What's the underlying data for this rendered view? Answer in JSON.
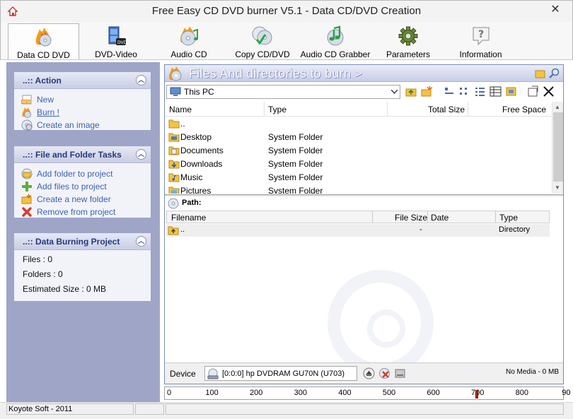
{
  "window": {
    "title": "Free Easy CD DVD burner V5.1 - Data CD/DVD Creation",
    "close_glyph": "✕"
  },
  "toolbar": {
    "items": [
      {
        "label": "Data CD DVD",
        "icon": "data-cd-fire-icon",
        "active": true
      },
      {
        "label": "DVD-Video",
        "icon": "dvd-film-icon"
      },
      {
        "label": "Audio CD",
        "icon": "audio-cd-icon"
      },
      {
        "label": "Copy CD/DVD",
        "icon": "copy-cd-icon"
      },
      {
        "label": "Audio CD Grabber",
        "icon": "audio-grabber-icon"
      },
      {
        "label": "Parameters",
        "icon": "gear-icon"
      },
      {
        "label": "Information",
        "icon": "help-icon"
      }
    ]
  },
  "sidebar": {
    "action": {
      "title": "..:: Action",
      "items": [
        "New",
        "Burn !",
        "Create an image"
      ]
    },
    "tasks": {
      "title": "..:: File and Folder Tasks",
      "items": [
        "Add folder to project",
        "Add files to project",
        "Create a new folder",
        "Remove from project"
      ]
    },
    "project": {
      "title": "..:: Data Burning Project",
      "files": "Files : 0",
      "folders": "Folders : 0",
      "size": "Estimated Size : 0 MB"
    }
  },
  "browser": {
    "banner": "Files And directories to burn >",
    "location": "This PC",
    "columns": [
      "Name",
      "Type",
      "Total Size",
      "Free Space"
    ],
    "rows": [
      {
        "name": "..",
        "type": ""
      },
      {
        "name": "Desktop",
        "type": "System Folder"
      },
      {
        "name": "Documents",
        "type": "System Folder"
      },
      {
        "name": "Downloads",
        "type": "System Folder"
      },
      {
        "name": "Music",
        "type": "System Folder"
      },
      {
        "name": "Pictures",
        "type": "System Folder"
      }
    ]
  },
  "project_view": {
    "path_label": "Path:",
    "columns": [
      "Filename",
      "File Size",
      "Date",
      "Type"
    ],
    "rows": [
      {
        "filename": "..",
        "size": "-",
        "date": "",
        "type": "Directory"
      }
    ]
  },
  "device": {
    "label": "Device",
    "selected": "[0:0:0] hp DVDRAM GU70N (U703)",
    "media": "No Media - 0 MB"
  },
  "ruler": {
    "labels": [
      "0",
      "100",
      "200",
      "300",
      "400",
      "500",
      "600",
      "700",
      "800",
      "90"
    ],
    "capacity_mark": 700
  },
  "status": {
    "text": "Koyote Soft - 2011"
  }
}
